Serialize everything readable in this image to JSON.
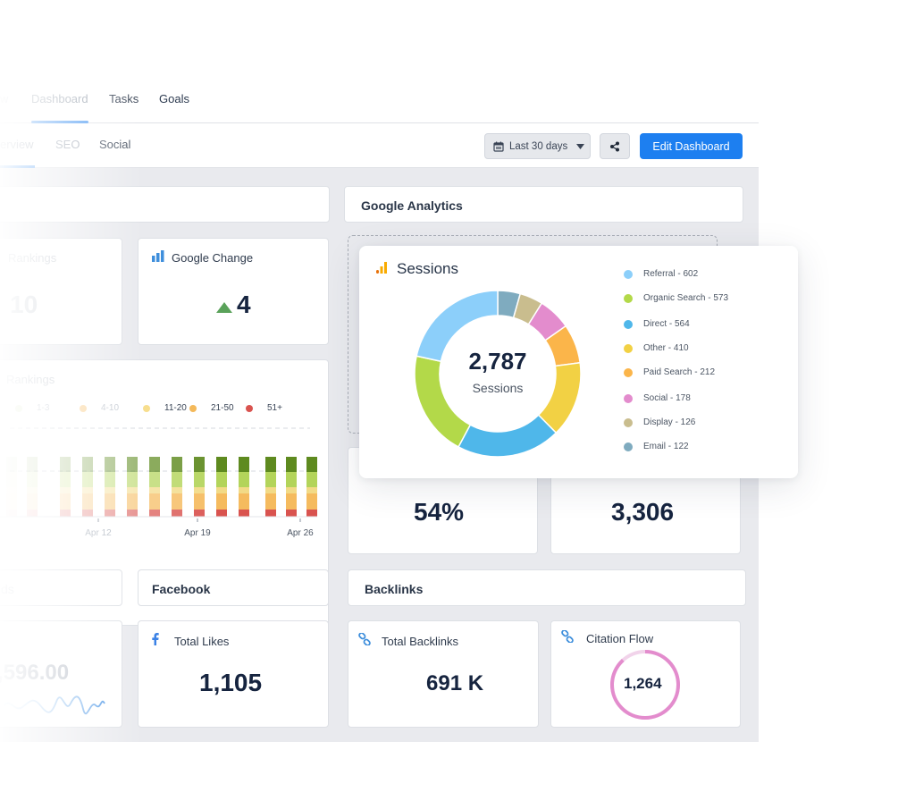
{
  "nav": {
    "tabs": [
      {
        "label": "w"
      },
      {
        "label": "Dashboard"
      },
      {
        "label": "Tasks"
      },
      {
        "label": "Goals"
      }
    ]
  },
  "subnav": {
    "tabs": [
      {
        "label": "erview"
      },
      {
        "label": "SEO"
      },
      {
        "label": "Social"
      }
    ],
    "date_range": "Last 30 days",
    "edit_label": "Edit Dashboard"
  },
  "sections": {
    "google_analytics": "Google Analytics",
    "facebook": "Facebook",
    "backlinks": "Backlinks",
    "left_partial": "ds"
  },
  "widgets": {
    "rankings_label": "Rankings",
    "rankings_value": "10",
    "google_change_label": "Google Change",
    "google_change_value": "4",
    "rank_chart_label": "Rankings",
    "bounce_value": "54%",
    "pageviews_value": "3,306",
    "revenue_value": ",596.00",
    "total_likes_label": "Total Likes",
    "total_likes_value": "1,105",
    "total_backlinks_label": "Total Backlinks",
    "total_backlinks_value": "691 K",
    "citation_flow_label": "Citation Flow",
    "citation_flow_value": "1,264"
  },
  "rank_legend": [
    {
      "label": "1-3",
      "color": "#e5efd3"
    },
    {
      "label": "4-10",
      "color": "#fbd9a6"
    },
    {
      "label": "11-20",
      "color": "#f7de8e"
    },
    {
      "label": "21-50",
      "color": "#f4b95a"
    },
    {
      "label": "51+",
      "color": "#d9534f"
    }
  ],
  "rank_axis": [
    "Apr 12",
    "Apr 19",
    "Apr 26"
  ],
  "sessions": {
    "title": "Sessions",
    "total": "2,787",
    "total_label": "Sessions"
  },
  "chart_data": {
    "type": "pie",
    "title": "Sessions",
    "center_value": "2,787",
    "center_label": "Sessions",
    "categories": [
      "Referral",
      "Organic Search",
      "Direct",
      "Other",
      "Paid Search",
      "Social",
      "Display",
      "Email"
    ],
    "values": [
      602,
      573,
      564,
      410,
      212,
      178,
      126,
      122
    ],
    "colors": [
      "#8ccffa",
      "#b3d949",
      "#4fb7ea",
      "#f2d144",
      "#fbb54a",
      "#e38ccd",
      "#c9bd8e",
      "#7fabbf"
    ],
    "legend_labels": [
      "Referral - 602",
      "Organic Search - 573",
      "Direct - 564",
      "Other - 410",
      "Paid Search - 212",
      "Social - 178",
      "Display - 126",
      "Email - 122"
    ],
    "legend": "right"
  },
  "colors": {
    "accent": "#1d7ff0",
    "positive": "#5aa25a",
    "citation_ring": "#e38ccd"
  }
}
